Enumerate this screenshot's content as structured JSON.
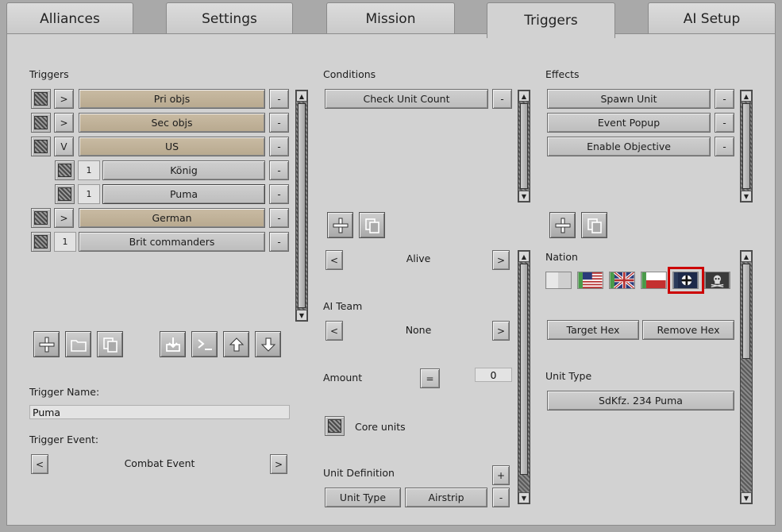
{
  "tabs": [
    {
      "label": "Alliances"
    },
    {
      "label": "Settings"
    },
    {
      "label": "Mission"
    },
    {
      "label": "Triggers"
    },
    {
      "label": "AI Setup"
    }
  ],
  "triggers": {
    "title": "Triggers",
    "items": [
      {
        "toggle": ">",
        "label": "Pri objs",
        "remove": "-"
      },
      {
        "toggle": ">",
        "label": "Sec objs",
        "remove": "-"
      },
      {
        "toggle": "V",
        "label": "US",
        "remove": "-"
      },
      {
        "toggle": "1",
        "label": "König",
        "remove": "-"
      },
      {
        "toggle": "1",
        "label": "Puma",
        "remove": "-"
      },
      {
        "toggle": ">",
        "label": "German",
        "remove": "-"
      },
      {
        "toggle": "1",
        "label": "Brit commanders",
        "remove": "-"
      }
    ],
    "name_label": "Trigger Name:",
    "name_value": "Puma",
    "event_label": "Trigger Event:",
    "event_value": "Combat Event",
    "prev": "<",
    "next": ">"
  },
  "conditions": {
    "title": "Conditions",
    "items": [
      {
        "label": "Check Unit Count",
        "remove": "-"
      }
    ],
    "alive_value": "Alive",
    "ai_team_label": "AI Team",
    "ai_team_value": "None",
    "amount_label": "Amount",
    "amount_op": "=",
    "amount_value": "0",
    "core_units_label": "Core units",
    "unit_def_label": "Unit Definition",
    "unit_def_add": "+",
    "unit_type_label": "Unit Type",
    "unit_type_value": "Airstrip",
    "unit_def_remove": "-",
    "prev": "<",
    "next": ">"
  },
  "effects": {
    "title": "Effects",
    "items": [
      {
        "label": "Spawn Unit",
        "remove": "-"
      },
      {
        "label": "Event Popup",
        "remove": "-"
      },
      {
        "label": "Enable Objective",
        "remove": "-"
      }
    ],
    "nation_label": "Nation",
    "target_hex": "Target Hex",
    "remove_hex": "Remove Hex",
    "unit_type_label": "Unit Type",
    "unit_type_value": "SdKfz. 234 Puma"
  },
  "colors": {
    "selected_highlight": "#cc0000",
    "trigger_folder": "#c2b49b",
    "panel": "#d2d2d2"
  }
}
